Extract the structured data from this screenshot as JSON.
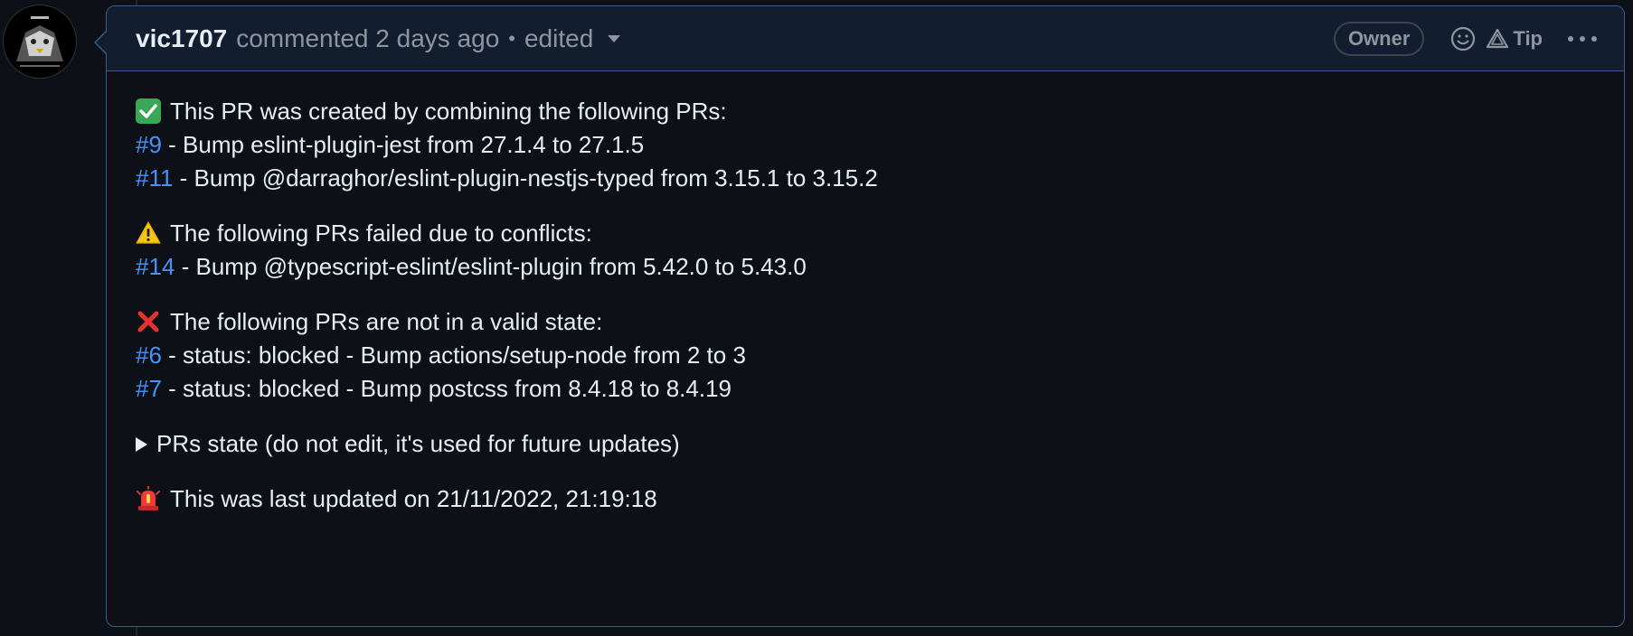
{
  "comment": {
    "author": "vic1707",
    "action": "commented 2 days ago",
    "separator": "•",
    "edited_label": "edited",
    "role_badge": "Owner",
    "tip_label": "Tip"
  },
  "sections": {
    "combined": {
      "emoji": "check-mark-emoji",
      "heading": "This PR was created by combining the following PRs:",
      "items": [
        {
          "link": "#9",
          "text": " - Bump eslint-plugin-jest from 27.1.4 to 27.1.5"
        },
        {
          "link": "#11",
          "text": " - Bump @darraghor/eslint-plugin-nestjs-typed from 3.15.1 to 3.15.2"
        }
      ]
    },
    "conflicts": {
      "emoji": "warning-emoji",
      "heading": "The following PRs failed due to conflicts:",
      "items": [
        {
          "link": "#14",
          "text": " - Bump @typescript-eslint/eslint-plugin from 5.42.0 to 5.43.0"
        }
      ]
    },
    "invalid": {
      "emoji": "cross-mark-emoji",
      "heading": "The following PRs are not in a valid state:",
      "items": [
        {
          "link": "#6",
          "text": " - status: blocked - Bump actions/setup-node from 2 to 3"
        },
        {
          "link": "#7",
          "text": " - status: blocked - Bump postcss from 8.4.18 to 8.4.19"
        }
      ]
    }
  },
  "details_summary": "PRs state (do not edit, it's used for future updates)",
  "last_updated": {
    "emoji": "rotating-light-emoji",
    "text": "This was last updated on 21/11/2022, 21:19:18"
  },
  "colors": {
    "background": "#0d1117",
    "header_bg": "#121d2f",
    "border": "#3a5b8c",
    "link": "#4493f8",
    "muted": "#8d96a0",
    "text": "#e6edf3"
  }
}
